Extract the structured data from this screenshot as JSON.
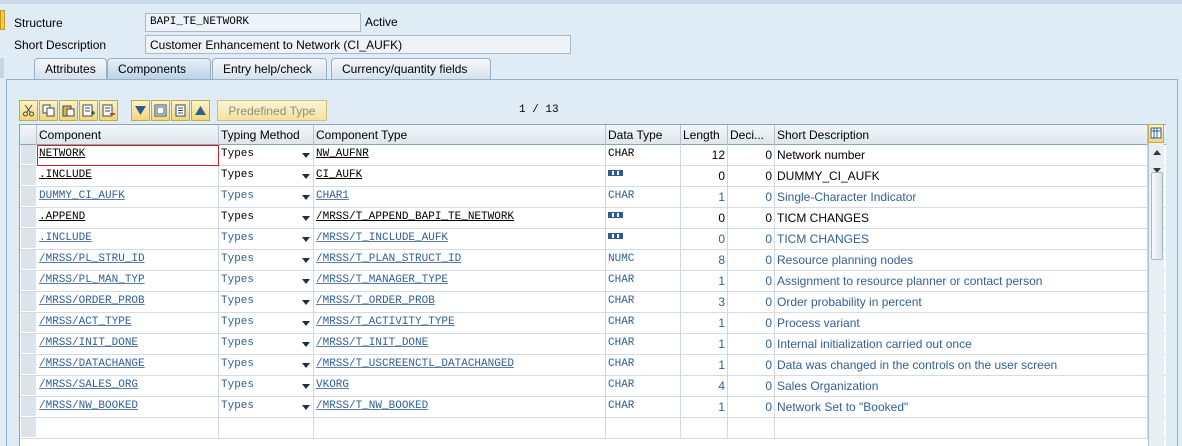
{
  "header": {
    "structure_label": "Structure",
    "structure_value": "BAPI_TE_NETWORK",
    "status": "Active",
    "short_desc_label": "Short Description",
    "short_desc_value": "Customer Enhancement to Network (CI_AUFK)"
  },
  "tabs": [
    {
      "label": "Attributes",
      "active": false
    },
    {
      "label": "Components",
      "active": true
    },
    {
      "label": "Entry help/check",
      "active": false
    },
    {
      "label": "Currency/quantity fields",
      "active": false
    }
  ],
  "toolbar": {
    "icons": [
      "cut-icon",
      "copy-icon",
      "paste-icon",
      "insert-row-icon",
      "delete-row-icon",
      "move-down-icon",
      "details-icon",
      "properties-icon",
      "move-up-icon"
    ],
    "predefined_type_label": "Predefined Type",
    "pager": "1 / 13"
  },
  "table": {
    "columns": [
      "Component",
      "Typing Method",
      "Component Type",
      "Data Type",
      "Length",
      "Deci...",
      "Short Description"
    ],
    "rows": [
      {
        "component": "NETWORK",
        "typing": "Types",
        "comp_type": "NW_AUFNR",
        "data_type": "CHAR",
        "length": "12",
        "deci": "0",
        "desc": "Network number",
        "style": "dark"
      },
      {
        "component": ".INCLUDE",
        "typing": "Types",
        "comp_type": "CI_AUFK",
        "data_type": "",
        "length": "0",
        "deci": "0",
        "desc": "DUMMY_CI_AUFK",
        "style": "dark",
        "struct_icon": true
      },
      {
        "component": "DUMMY_CI_AUFK",
        "typing": "Types",
        "comp_type": "CHAR1",
        "data_type": "CHAR",
        "length": "1",
        "deci": "0",
        "desc": "Single-Character Indicator",
        "style": "blue"
      },
      {
        "component": ".APPEND",
        "typing": "Types",
        "comp_type": "/MRSS/T_APPEND_BAPI_TE_NETWORK",
        "data_type": "",
        "length": "0",
        "deci": "0",
        "desc": "TICM CHANGES",
        "style": "dark",
        "struct_icon": true
      },
      {
        "component": ".INCLUDE",
        "typing": "Types",
        "comp_type": "/MRSS/T_INCLUDE_AUFK",
        "data_type": "",
        "length": "0",
        "deci": "0",
        "desc": "TICM CHANGES",
        "style": "blue",
        "struct_icon": true
      },
      {
        "component": "/MRSS/PL_STRU_ID",
        "typing": "Types",
        "comp_type": "/MRSS/T_PLAN_STRUCT_ID",
        "data_type": "NUMC",
        "length": "8",
        "deci": "0",
        "desc": "Resource planning nodes",
        "style": "blue"
      },
      {
        "component": "/MRSS/PL_MAN_TYP",
        "typing": "Types",
        "comp_type": "/MRSS/T_MANAGER_TYPE",
        "data_type": "CHAR",
        "length": "1",
        "deci": "0",
        "desc": "Assignment to resource planner or contact person",
        "style": "blue"
      },
      {
        "component": "/MRSS/ORDER_PROB",
        "typing": "Types",
        "comp_type": "/MRSS/T_ORDER_PROB",
        "data_type": "CHAR",
        "length": "3",
        "deci": "0",
        "desc": "Order probability in percent",
        "style": "blue"
      },
      {
        "component": "/MRSS/ACT_TYPE",
        "typing": "Types",
        "comp_type": "/MRSS/T_ACTIVITY_TYPE",
        "data_type": "CHAR",
        "length": "1",
        "deci": "0",
        "desc": "Process variant",
        "style": "blue"
      },
      {
        "component": "/MRSS/INIT_DONE",
        "typing": "Types",
        "comp_type": "/MRSS/T_INIT_DONE",
        "data_type": "CHAR",
        "length": "1",
        "deci": "0",
        "desc": "Internal initialization carried out once",
        "style": "blue"
      },
      {
        "component": "/MRSS/DATACHANGE",
        "typing": "Types",
        "comp_type": "/MRSS/T_USCREENCTL_DATACHANGED",
        "data_type": "CHAR",
        "length": "1",
        "deci": "0",
        "desc": "Data was changed in the controls on the user screen",
        "style": "blue"
      },
      {
        "component": "/MRSS/SALES_ORG",
        "typing": "Types",
        "comp_type": "VKORG",
        "data_type": "CHAR",
        "length": "4",
        "deci": "0",
        "desc": "Sales Organization",
        "style": "blue"
      },
      {
        "component": "/MRSS/NW_BOOKED",
        "typing": "Types",
        "comp_type": "/MRSS/T_NW_BOOKED",
        "data_type": "CHAR",
        "length": "1",
        "deci": "0",
        "desc": "Network Set to \"Booked\"",
        "style": "blue"
      }
    ]
  }
}
